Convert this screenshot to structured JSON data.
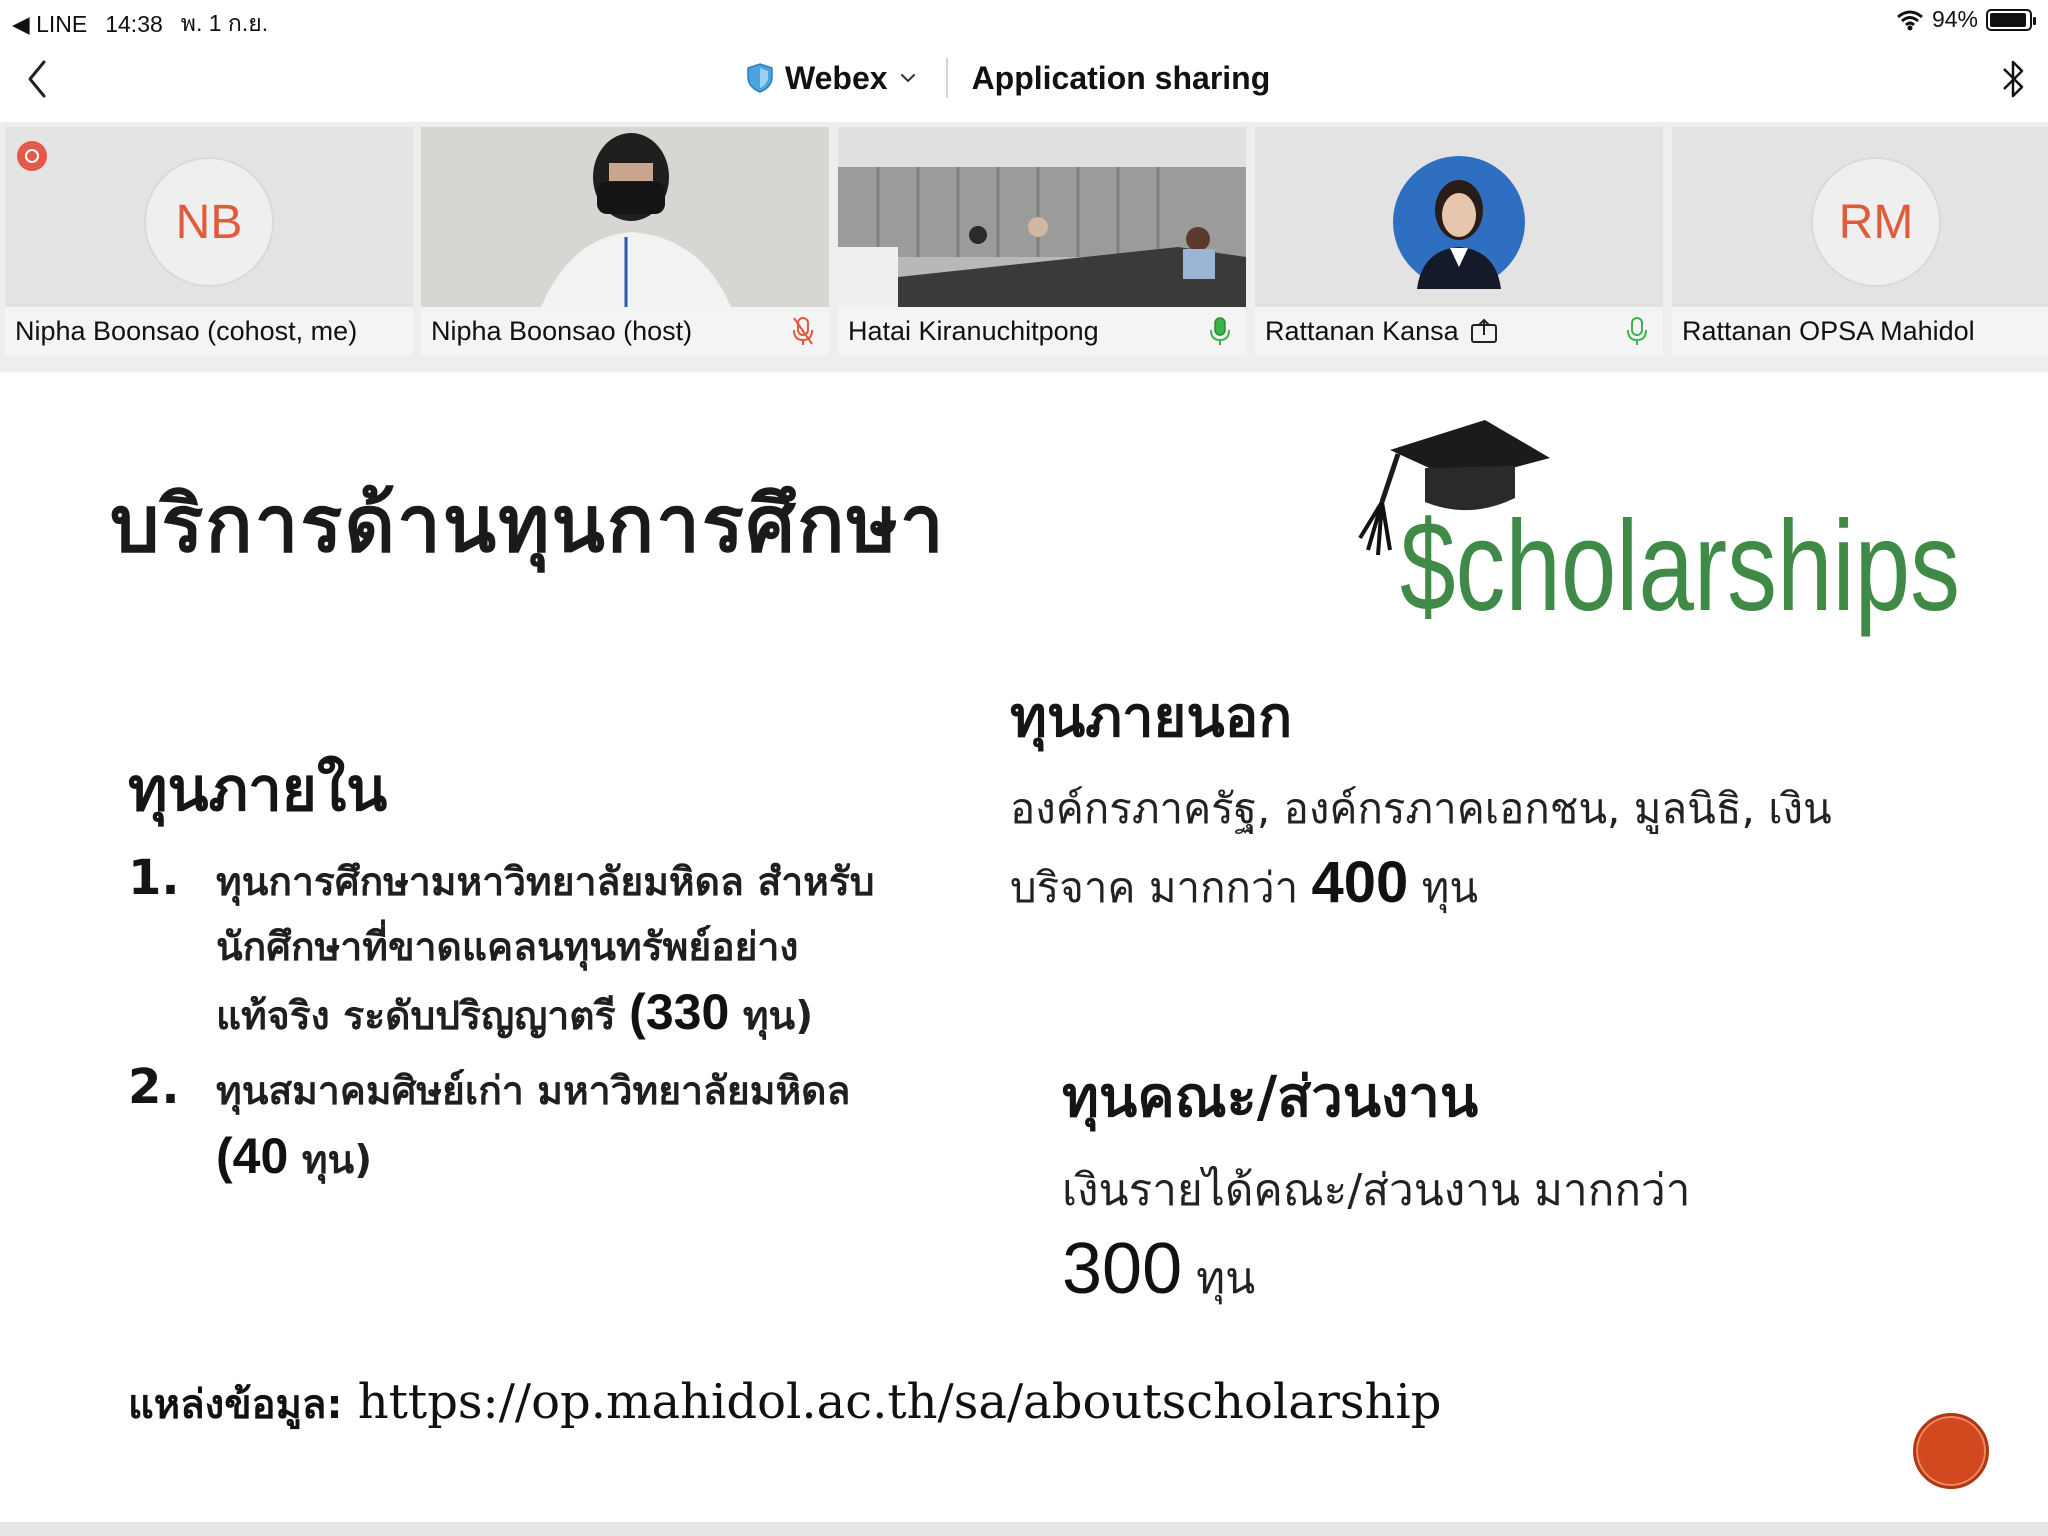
{
  "status": {
    "back_app": "◀ LINE",
    "time": "14:38",
    "date": "พ. 1 ก.ย.",
    "battery": "94%",
    "battery_level": 0.94
  },
  "nav": {
    "meeting_app": "Webex",
    "title": "Application sharing"
  },
  "participants": [
    {
      "name": "Nipha Boonsao (cohost, me)",
      "initials": "NB",
      "recording": true
    },
    {
      "name": "Nipha Boonsao (host)",
      "mic": "muted"
    },
    {
      "name": "Hatai Kiranuchitpong",
      "mic": "on"
    },
    {
      "name": "Rattanan Kansa",
      "mic": "on",
      "sharing": true
    },
    {
      "name": "Rattanan OPSA Mahidol",
      "initials": "RM"
    }
  ],
  "slide": {
    "title": "บริการด้านทุนการศึกษา",
    "logo_text": "$cholarships",
    "internal": {
      "heading": "ทุนภายใน",
      "items": [
        {
          "num": "1.",
          "text": "ทุนการศึกษามหาวิทยาลัยมหิดล สำหรับนักศึกษาที่ขาดแคลนทุนทรัพย์อย่างแท้จริง ระดับปริญญาตรี",
          "count": "(330",
          "unit": "ทุน)"
        },
        {
          "num": "2.",
          "text": "ทุนสมาคมศิษย์เก่า มหาวิทยาลัยมหิดล",
          "count": "(40",
          "unit": "ทุน)"
        }
      ]
    },
    "external": {
      "heading": "ทุนภายนอก",
      "text": "องค์กรภาครัฐ, องค์กรภาคเอกชน, มูลนิธิ, เงินบริจาค มากกว่า",
      "count": "400",
      "unit": "ทุน"
    },
    "faculty": {
      "heading": "ทุนคณะ/ส่วนงาน",
      "text": "เงินรายได้คณะ/ส่วนงาน มากกว่า",
      "count": "300",
      "unit": "ทุน"
    },
    "source_label": "แหล่งข้อมูล:",
    "source_url": "https://op.mahidol.ac.th/sa/aboutscholarship"
  }
}
